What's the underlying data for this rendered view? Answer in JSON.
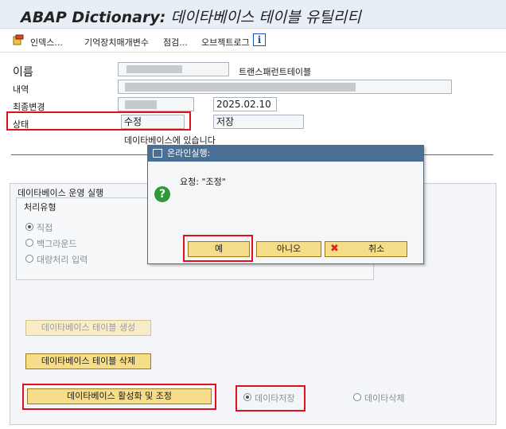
{
  "header": {
    "title_bold": "ABAP Dictionary:",
    "title_rest": " 데이타베이스 테이블 유틸리티"
  },
  "toolbar": {
    "index_label": "인덱스...",
    "storage_params_label": "기억장치매개변수",
    "check_label": "점검...",
    "object_log_label": "오브젝트로그",
    "info_label": "i"
  },
  "form": {
    "name_label": "이름",
    "name_value": "",
    "table_type": "트랜스패런트테이블",
    "desc_label": "내역",
    "last_changed_label": "최종변경",
    "last_changed_date": "2025.02.10",
    "status_label": "상태",
    "status_value": "수정",
    "status_saved": "저장",
    "db_status": "데이타베이스에 있습니다"
  },
  "db_ops": {
    "group_title": "데이타베이스 운영 실행",
    "processing_title": "처리유형",
    "radio_direct": "직접",
    "radio_background": "백그라운드",
    "radio_mass": "대량처리 입력",
    "btn_create": "데이타베이스 테이블 생성",
    "btn_delete": "데이타베이스 테이블 삭제",
    "btn_activate": "데이타베이스 활성화 및 조정",
    "radio_save_data": "데이타저장",
    "radio_delete_data": "데이타삭제"
  },
  "dialog": {
    "title": "온라인실행:",
    "message": "요청: \"조정\"",
    "yes": "예",
    "no": "아니오",
    "cancel": "취소",
    "cancel_icon": "x-icon",
    "question_icon": "question-icon"
  },
  "colors": {
    "highlight_red": "#e0101a",
    "button_yellow": "#f6dd8a",
    "dialog_title_bg": "#4a6f94"
  }
}
